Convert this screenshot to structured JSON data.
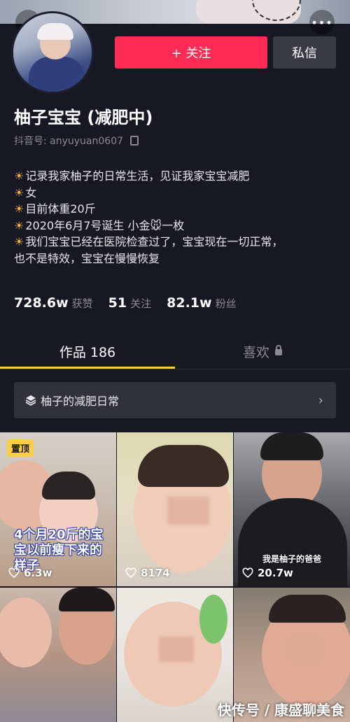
{
  "header": {
    "back_icon": "chevron-left-icon",
    "more_label": "•••"
  },
  "profile": {
    "follow_label": "+ 关注",
    "message_label": "私信",
    "nickname": "柚子宝宝 (减肥中)",
    "douyin_id": "抖音号: anyuyuan0607",
    "bio_lines": [
      "记录我家柚子的日常生活，见证我家宝宝减肥",
      "女",
      "目前体重20斤",
      "2020年6月7号诞生 小金🐭一枚",
      "我们宝宝已经在医院检查过了，宝宝现在一切正常，",
      "也不是特效，宝宝在慢慢恢复"
    ],
    "stats": {
      "likes_num": "728.6w",
      "likes_label": "获赞",
      "following_num": "51",
      "following_label": "关注",
      "followers_num": "82.1w",
      "followers_label": "粉丝"
    }
  },
  "tabs": {
    "works": "作品 186",
    "likes": "喜欢"
  },
  "collection": {
    "title": "柚子的减肥日常"
  },
  "videos": [
    {
      "pinned_label": "置顶",
      "caption": "4个月20斤的宝宝以前瘦下来的样子",
      "likes": "6.3w"
    },
    {
      "likes": "8174"
    },
    {
      "caption": "我是柚子的爸爸",
      "likes": "20.7w"
    },
    {},
    {},
    {}
  ],
  "watermark": "快传号 / 康盛聊美食",
  "colors": {
    "background": "#161823",
    "follow": "#fe2c55",
    "accent": "#fcce43",
    "muted": "#8a8b91"
  }
}
